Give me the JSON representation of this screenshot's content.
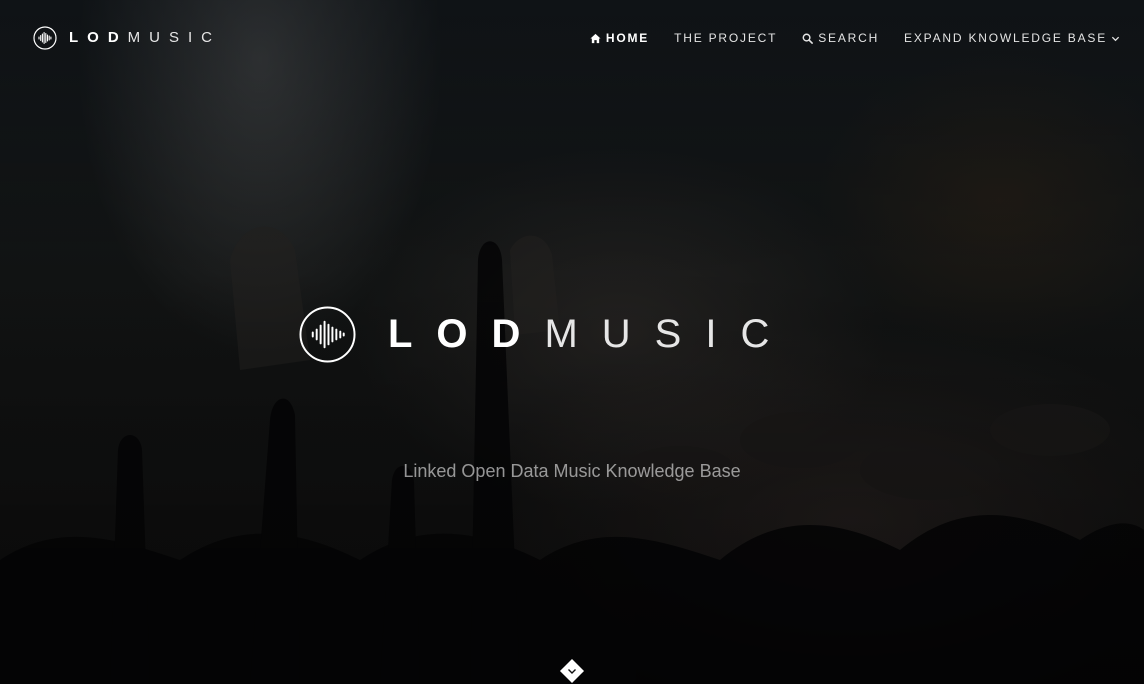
{
  "brand": {
    "bold": "LOD",
    "thin": "MUSIC",
    "icon": "soundwave-icon"
  },
  "nav": {
    "items": [
      {
        "label": "HOME",
        "icon": "home-icon",
        "active": true
      },
      {
        "label": "THE PROJECT",
        "active": false
      },
      {
        "label": "SEARCH",
        "icon": "search-icon",
        "active": false
      },
      {
        "label": "EXPAND KNOWLEDGE BASE",
        "icon": "chevron-down-icon",
        "active": false
      }
    ]
  },
  "hero": {
    "title_bold": "LOD",
    "title_thin": "MUSIC",
    "tagline": "Linked Open Data Music Knowledge Base",
    "scroll_icon": "chevron-down-icon"
  },
  "colors": {
    "text": "#ffffff",
    "nav_text": "#e4e4e4",
    "tagline": "#ebebeb"
  }
}
